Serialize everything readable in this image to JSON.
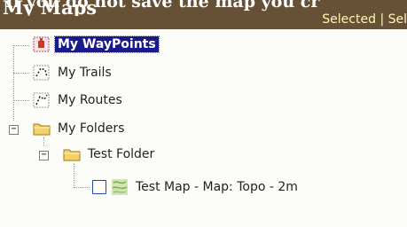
{
  "header": {
    "title": "My Maps",
    "background_text": "If you do not save the map you cr",
    "links": [
      "Selected",
      "|",
      "Sel"
    ]
  },
  "tree": {
    "waypoints": {
      "label": "My WayPoints",
      "icon": "waypoint-icon",
      "selected": true
    },
    "trails": {
      "label": "My Trails",
      "icon": "trail-icon"
    },
    "routes": {
      "label": "My Routes",
      "icon": "route-icon"
    },
    "folders": {
      "label": "My Folders",
      "icon": "folder-icon",
      "expanded": true,
      "children": [
        {
          "label": "Test Folder",
          "icon": "folder-icon",
          "expanded": true,
          "children": [
            {
              "label": "Test Map - Map: Topo - 2m",
              "icon": "topo-map-icon",
              "checked": false
            }
          ]
        }
      ]
    }
  },
  "colors": {
    "header_bg": "#665137",
    "link_color": "#fff7b0",
    "selection_bg": "#1a1a8c",
    "folder_yellow": "#f4d26b"
  }
}
